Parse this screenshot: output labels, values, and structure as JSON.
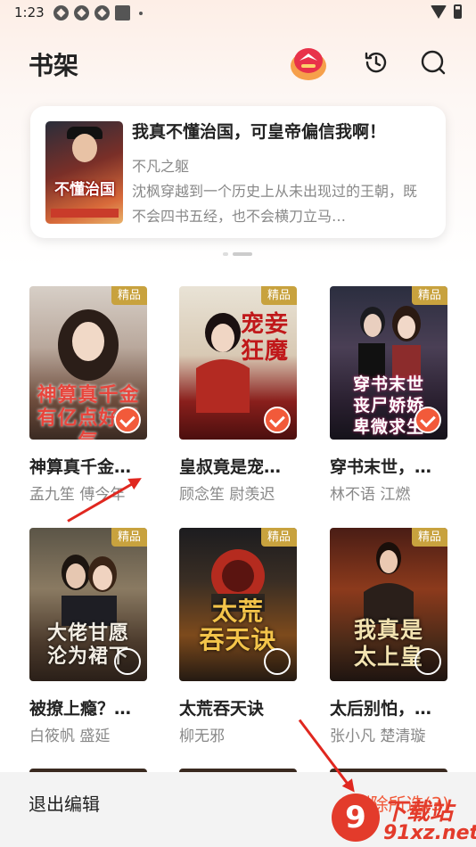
{
  "status_bar": {
    "time": "1:23"
  },
  "header": {
    "title": "书架",
    "icons": [
      "mascot-icon",
      "history-icon",
      "search-icon"
    ]
  },
  "featured": {
    "title": "我真不懂治国，可皇帝偏信我啊！",
    "author": "不凡之躯",
    "description": "沈枫穿越到一个历史上从未出现过的王朝，既不会四书五经，也不会横刀立马…",
    "cover_art_text": "不懂治国"
  },
  "pager": {
    "count": 2,
    "active": 1
  },
  "books": [
    {
      "title": "神算真千金…",
      "authors": "孟九笙  傅今年",
      "tag": "精品",
      "cover_art": "神算真千金 有亿点好运气",
      "selected": true
    },
    {
      "title": "皇叔竟是宠…",
      "authors": "顾念笙  尉羡迟",
      "tag": "精品",
      "cover_art": "宠妾狂魔",
      "selected": true
    },
    {
      "title": "穿书末世，…",
      "authors": "林不语  江燃",
      "tag": "精品",
      "cover_art": "穿书末世 丧尸娇娇 卑微求生",
      "selected": true
    },
    {
      "title": "被撩上瘾？…",
      "authors": "白筱帆  盛延",
      "tag": "精品",
      "cover_art": "大佬甘愿 沦为裙下",
      "selected": false
    },
    {
      "title": "太荒吞天诀",
      "authors": "柳无邪",
      "tag": "精品",
      "cover_art": "太荒 吞天诀",
      "selected": false
    },
    {
      "title": "太后别怕，…",
      "authors": "张小凡  楚清璇",
      "tag": "精品",
      "cover_art": "我真是 太上皇",
      "selected": false
    }
  ],
  "bottom_bar": {
    "exit_label": "退出编辑",
    "delete_label": "删除所选(3)"
  },
  "watermark": {
    "logo": "9",
    "cn": "下载站",
    "url": "91xz.net"
  },
  "colors": {
    "accent": "#f25a3a",
    "tag": "#c8a23e",
    "annotation_arrow": "#e0271f"
  }
}
